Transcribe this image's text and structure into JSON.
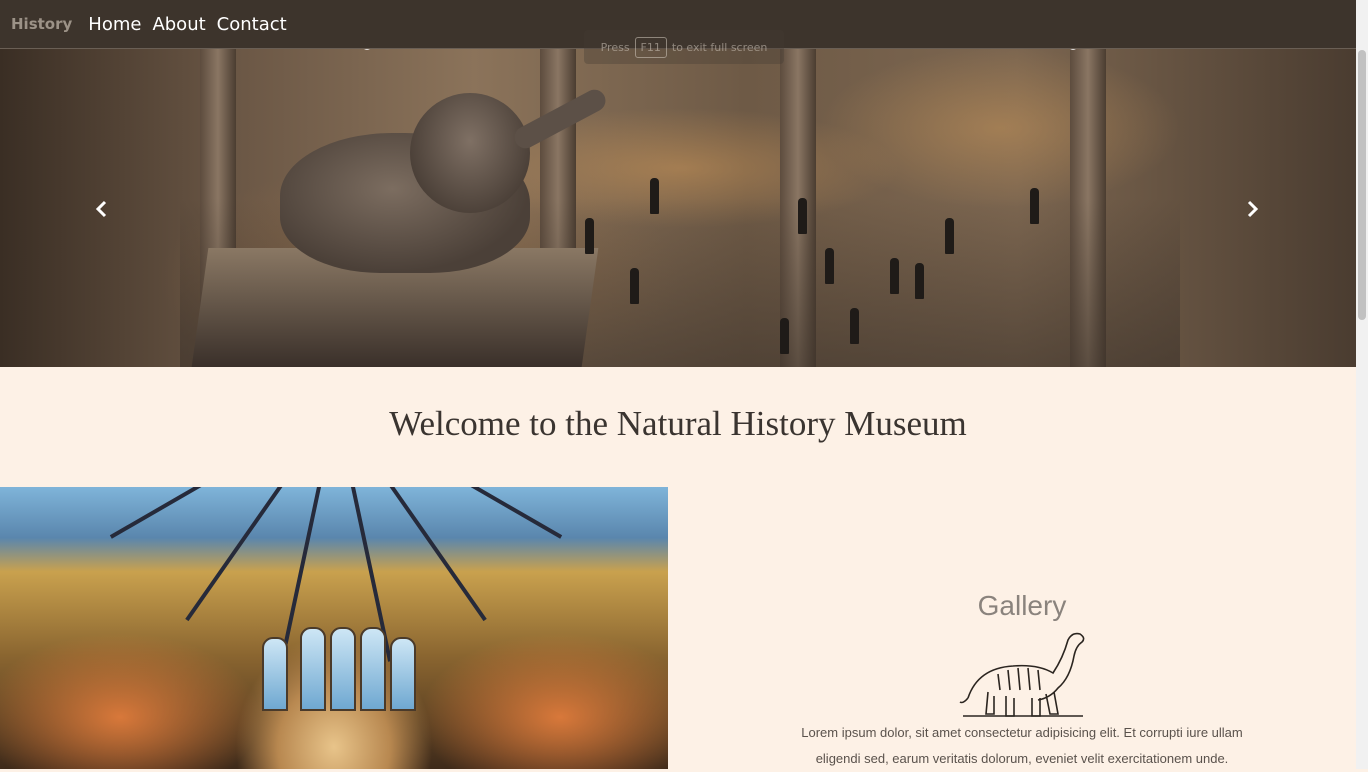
{
  "navbar": {
    "brand": "History",
    "links": [
      "Home",
      "About",
      "Contact"
    ]
  },
  "carousel": {
    "fullscreen_hint": {
      "before": "Press",
      "key": "F11",
      "after": "to exit full screen"
    },
    "prev_icon": "chevron-left-icon",
    "next_icon": "chevron-right-icon"
  },
  "welcome": {
    "title": "Welcome to the Natural History Museum"
  },
  "gallery": {
    "title": "Gallery",
    "line1": "Lorem ipsum dolor, sit amet consectetur adipisicing elit. Et corrupti iure ullam",
    "line2": "eligendi sed, earum veritatis dolorum, eveniet velit exercitationem unde."
  },
  "colors": {
    "navbar_bg": "#3d342c",
    "page_bg": "#fdf1e6",
    "brand": "#9c9287"
  }
}
